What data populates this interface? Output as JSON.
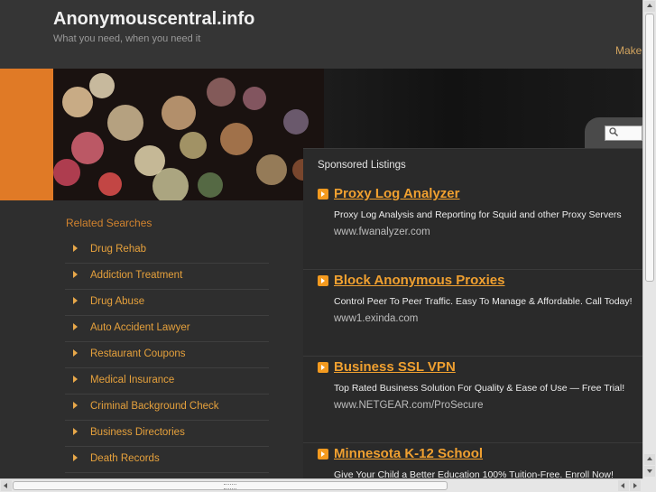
{
  "header": {
    "title": "Anonymouscentral.info",
    "tagline": "What you need, when you need it",
    "make_link": "Make"
  },
  "search": {
    "placeholder": ""
  },
  "related": {
    "title": "Related Searches",
    "items": [
      "Drug Rehab",
      "Addiction Treatment",
      "Drug Abuse",
      "Auto Accident Lawyer",
      "Restaurant Coupons",
      "Medical Insurance",
      "Criminal Background Check",
      "Business Directories",
      "Death Records"
    ]
  },
  "sponsored": {
    "title": "Sponsored Listings",
    "listings": [
      {
        "title": "Proxy Log Analyzer",
        "desc": "Proxy Log Analysis and Reporting for Squid and other Proxy Servers",
        "url": "www.fwanalyzer.com"
      },
      {
        "title": "Block Anonymous Proxies",
        "desc": "Control Peer To Peer Traffic. Easy To Manage & Affordable. Call Today!",
        "url": "www1.exinda.com"
      },
      {
        "title": "Business SSL VPN",
        "desc": "Top Rated Business Solution For Quality & Ease of Use — Free Trial!",
        "url": "www.NETGEAR.com/ProSecure"
      },
      {
        "title": "Minnesota K-12 School",
        "desc": "Give Your Child a Better Education 100% Tuition-Free. Enroll Now!",
        "url": ""
      }
    ]
  },
  "colors": {
    "accent_orange": "#e07a26",
    "link_orange": "#f0a030",
    "background": "#2e2e2e"
  }
}
